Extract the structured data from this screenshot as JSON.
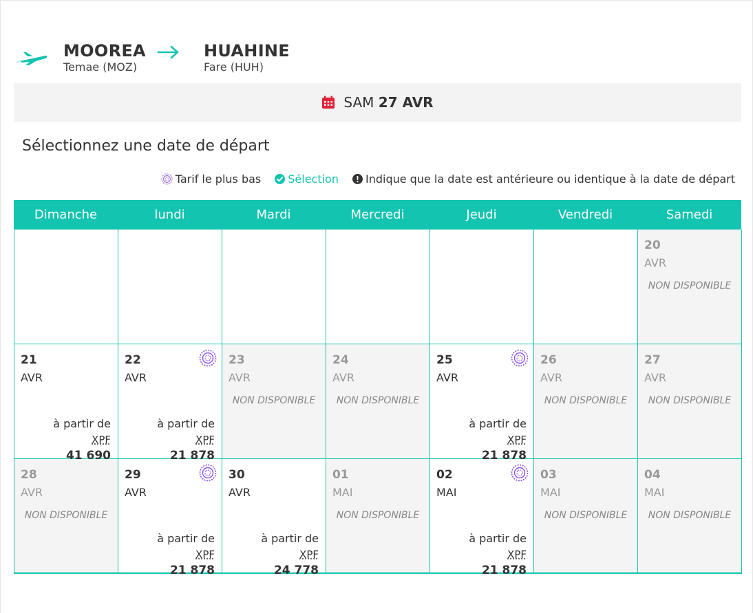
{
  "route": {
    "origin_city": "MOOREA",
    "origin_airport": "Temae (MOZ)",
    "destination_city": "HUAHINE",
    "destination_airport": "Fare (HUH)"
  },
  "selected_date": {
    "weekday": "SAM",
    "day_month": "27 AVR"
  },
  "subtitle": "Sélectionnez une date de départ",
  "legend": {
    "lowest": "Tarif le plus bas",
    "selection": "Sélection",
    "info": "Indique que la date est antérieure ou identique à la date de départ"
  },
  "weekdays": [
    "Dimanche",
    "lundi",
    "Mardi",
    "Mercredi",
    "Jeudi",
    "Vendredi",
    "Samedi"
  ],
  "labels": {
    "unavailable": "NON DISPONIBLE",
    "from": "à partir de",
    "currency": "XPF"
  },
  "colors": {
    "accent": "#13c4b0",
    "lowest_fare": "#8a4fe0",
    "calendar_icon": "#e0233a"
  },
  "weeks": [
    [
      {
        "empty": true
      },
      {
        "empty": true
      },
      {
        "empty": true
      },
      {
        "empty": true
      },
      {
        "empty": true
      },
      {
        "empty": true
      },
      {
        "day": "20",
        "month": "AVR",
        "unavailable": true
      }
    ],
    [
      {
        "day": "21",
        "month": "AVR",
        "price": "41 690"
      },
      {
        "day": "22",
        "month": "AVR",
        "price": "21 878",
        "lowest": true
      },
      {
        "day": "23",
        "month": "AVR",
        "unavailable": true
      },
      {
        "day": "24",
        "month": "AVR",
        "unavailable": true
      },
      {
        "day": "25",
        "month": "AVR",
        "price": "21 878",
        "lowest": true
      },
      {
        "day": "26",
        "month": "AVR",
        "unavailable": true
      },
      {
        "day": "27",
        "month": "AVR",
        "unavailable": true
      }
    ],
    [
      {
        "day": "28",
        "month": "AVR",
        "unavailable": true
      },
      {
        "day": "29",
        "month": "AVR",
        "price": "21 878",
        "lowest": true
      },
      {
        "day": "30",
        "month": "AVR",
        "price": "24 778"
      },
      {
        "day": "01",
        "month": "MAI",
        "unavailable": true
      },
      {
        "day": "02",
        "month": "MAI",
        "price": "21 878",
        "lowest": true
      },
      {
        "day": "03",
        "month": "MAI",
        "unavailable": true
      },
      {
        "day": "04",
        "month": "MAI",
        "unavailable": true
      }
    ]
  ]
}
